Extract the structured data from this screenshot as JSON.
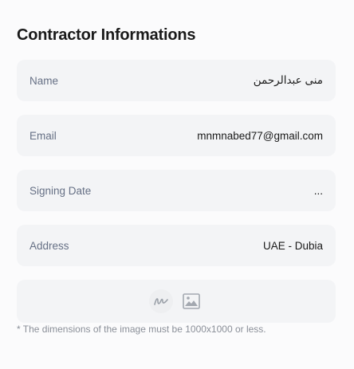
{
  "section": {
    "title": "Contractor Informations"
  },
  "fields": [
    {
      "label": "Name",
      "value": "منى عبدالرحمن"
    },
    {
      "label": "Email",
      "value": "mnmnabed77@gmail.com"
    },
    {
      "label": "Signing Date",
      "value": "..."
    },
    {
      "label": "Address",
      "value": "UAE - Dubia"
    }
  ],
  "upload": {
    "icons": [
      "signature-icon",
      "image-icon"
    ],
    "note": "* The dimensions of the image must be 1000x1000 or less."
  }
}
